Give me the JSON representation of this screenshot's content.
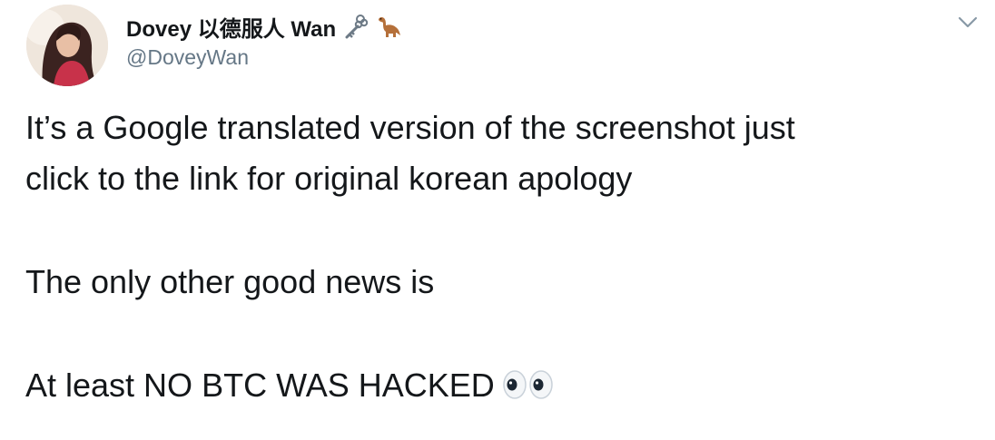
{
  "tweet": {
    "author": {
      "display_name": "Dovey 以德服人 Wan",
      "handle": "@DoveyWan",
      "name_emojis": [
        "old-key-emoji",
        "sauropod-emoji"
      ],
      "avatar": "profile-photo"
    },
    "menu_icon": "chevron-down-icon",
    "body": {
      "line1": "It’s a Google translated version of the screenshot just",
      "line2": "click to the link for original korean apology",
      "line3": "The only other good news is",
      "line4": "At least NO BTC WAS HACKED",
      "trailing_emoji": "eyes-emoji"
    },
    "colors": {
      "text": "#14171a",
      "secondary": "#657786",
      "chevron": "#8899a6"
    }
  }
}
